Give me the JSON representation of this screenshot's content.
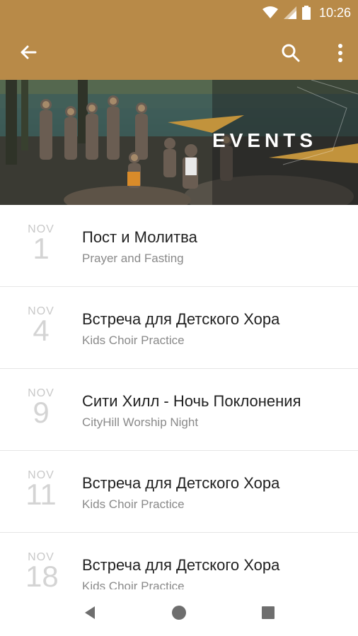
{
  "status_bar": {
    "time": "10:26"
  },
  "app_bar": {
    "back_icon": "arrow-left-icon",
    "search_icon": "search-icon",
    "menu_icon": "more-vert-icon",
    "color": "#b88a48"
  },
  "hero": {
    "title": "EVENTS"
  },
  "events": [
    {
      "month": "NOV",
      "day": "1",
      "title": "Пост и Молитва",
      "subtitle": "Prayer and Fasting"
    },
    {
      "month": "NOV",
      "day": "4",
      "title": "Встреча для Детского Хора",
      "subtitle": "Kids Choir Practice"
    },
    {
      "month": "NOV",
      "day": "9",
      "title": "Сити Хилл - Ночь Поклонения",
      "subtitle": "CityHill Worship Night"
    },
    {
      "month": "NOV",
      "day": "11",
      "title": "Встреча для Детского Хора",
      "subtitle": "Kids Choir Practice"
    },
    {
      "month": "NOV",
      "day": "18",
      "title": "Встреча для Детского Хора",
      "subtitle": "Kids Choir Practice"
    }
  ],
  "nav_bar": {
    "back_icon": "nav-back-icon",
    "home_icon": "nav-home-icon",
    "recents_icon": "nav-recents-icon"
  }
}
